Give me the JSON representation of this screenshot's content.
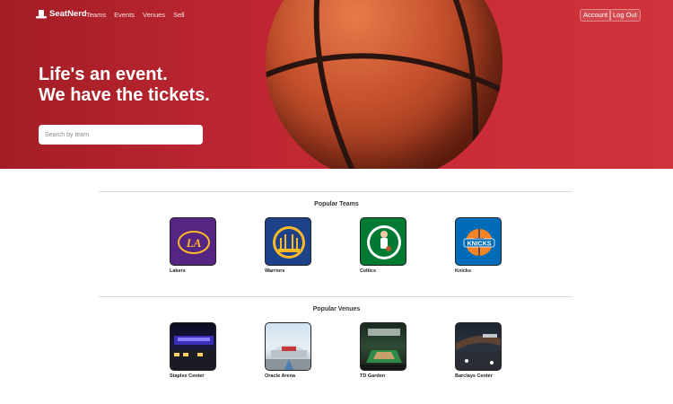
{
  "nav": {
    "brand": "SeatNerd",
    "links": [
      "Teams",
      "Events",
      "Venues",
      "Sell"
    ],
    "account_label": "Account",
    "logout_label": "Log Out"
  },
  "hero": {
    "headline_line1": "Life's an event.",
    "headline_line2": "We have the tickets.",
    "search_placeholder": "Search by team"
  },
  "popular_teams": {
    "title": "Popular Teams",
    "items": [
      {
        "name": "Lakers",
        "color": "#552583",
        "logo_icon": "lakers-logo"
      },
      {
        "name": "Warriors",
        "color": "#1d428a",
        "logo_icon": "warriors-logo"
      },
      {
        "name": "Celtics",
        "color": "#007a33",
        "logo_icon": "celtics-logo"
      },
      {
        "name": "Knicks",
        "color": "#006bb6",
        "logo_icon": "knicks-logo"
      }
    ]
  },
  "popular_venues": {
    "title": "Popular Venues",
    "items": [
      {
        "name": "Staples Center",
        "photo_icon": "staples-center-photo"
      },
      {
        "name": "Oracle Arena",
        "photo_icon": "oracle-arena-photo"
      },
      {
        "name": "TD Garden",
        "photo_icon": "td-garden-photo"
      },
      {
        "name": "Barclays Center",
        "photo_icon": "barclays-center-photo"
      }
    ]
  },
  "colors": {
    "hero_red": "#c62a34",
    "accent": "#a31d25"
  }
}
